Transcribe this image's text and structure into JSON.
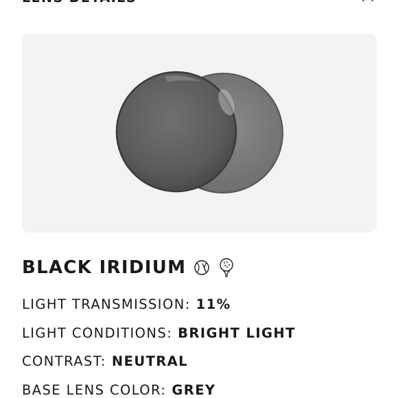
{
  "header": {
    "title": "LENS DETAILS"
  },
  "lens": {
    "name": "BLACK IRIDIUM",
    "activity_icons": [
      "baseball-icon",
      "golf-icon"
    ]
  },
  "specs": [
    {
      "label": "LIGHT TRANSMISSION:",
      "value": "11%"
    },
    {
      "label": "LIGHT CONDITIONS:",
      "value": "BRIGHT LIGHT"
    },
    {
      "label": "CONTRAST:",
      "value": "NEUTRAL"
    },
    {
      "label": "BASE LENS COLOR:",
      "value": "GREY"
    }
  ],
  "colors": {
    "close_icon": "#b5352b",
    "card_background": "#f3f3f3",
    "text": "#1a1a1a"
  }
}
